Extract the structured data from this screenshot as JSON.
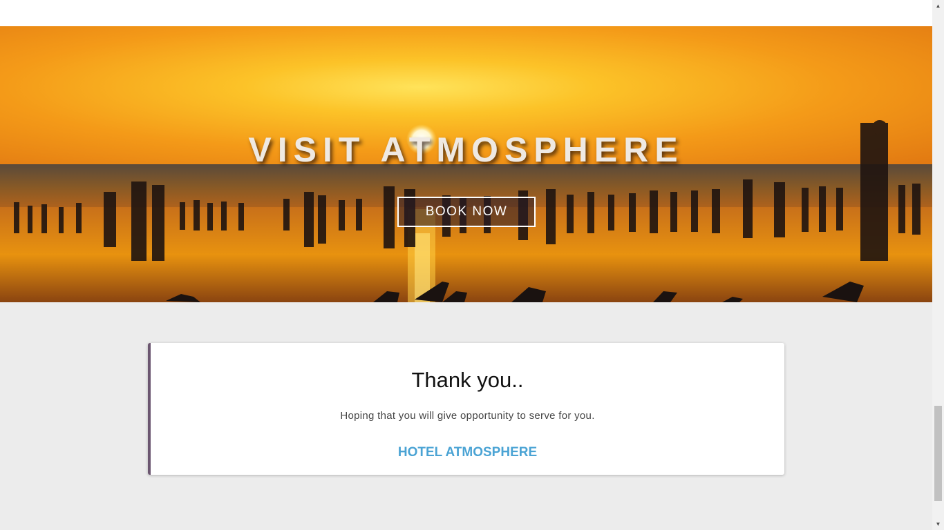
{
  "hero": {
    "title": "VISIT ATMOSPHERE",
    "button_label": "BOOK NOW",
    "image": "beach-sunset-crowd"
  },
  "card": {
    "title": "Thank you..",
    "message": "Hoping that you will give opportunity to serve for you.",
    "link_label": "HOTEL ATMOSPHERE"
  },
  "scrollbar": {
    "up_icon": "▲",
    "down_icon": "▼"
  },
  "colors": {
    "card_accent": "#6b5670",
    "link": "#4aa3d4",
    "page_background": "#ececec"
  }
}
